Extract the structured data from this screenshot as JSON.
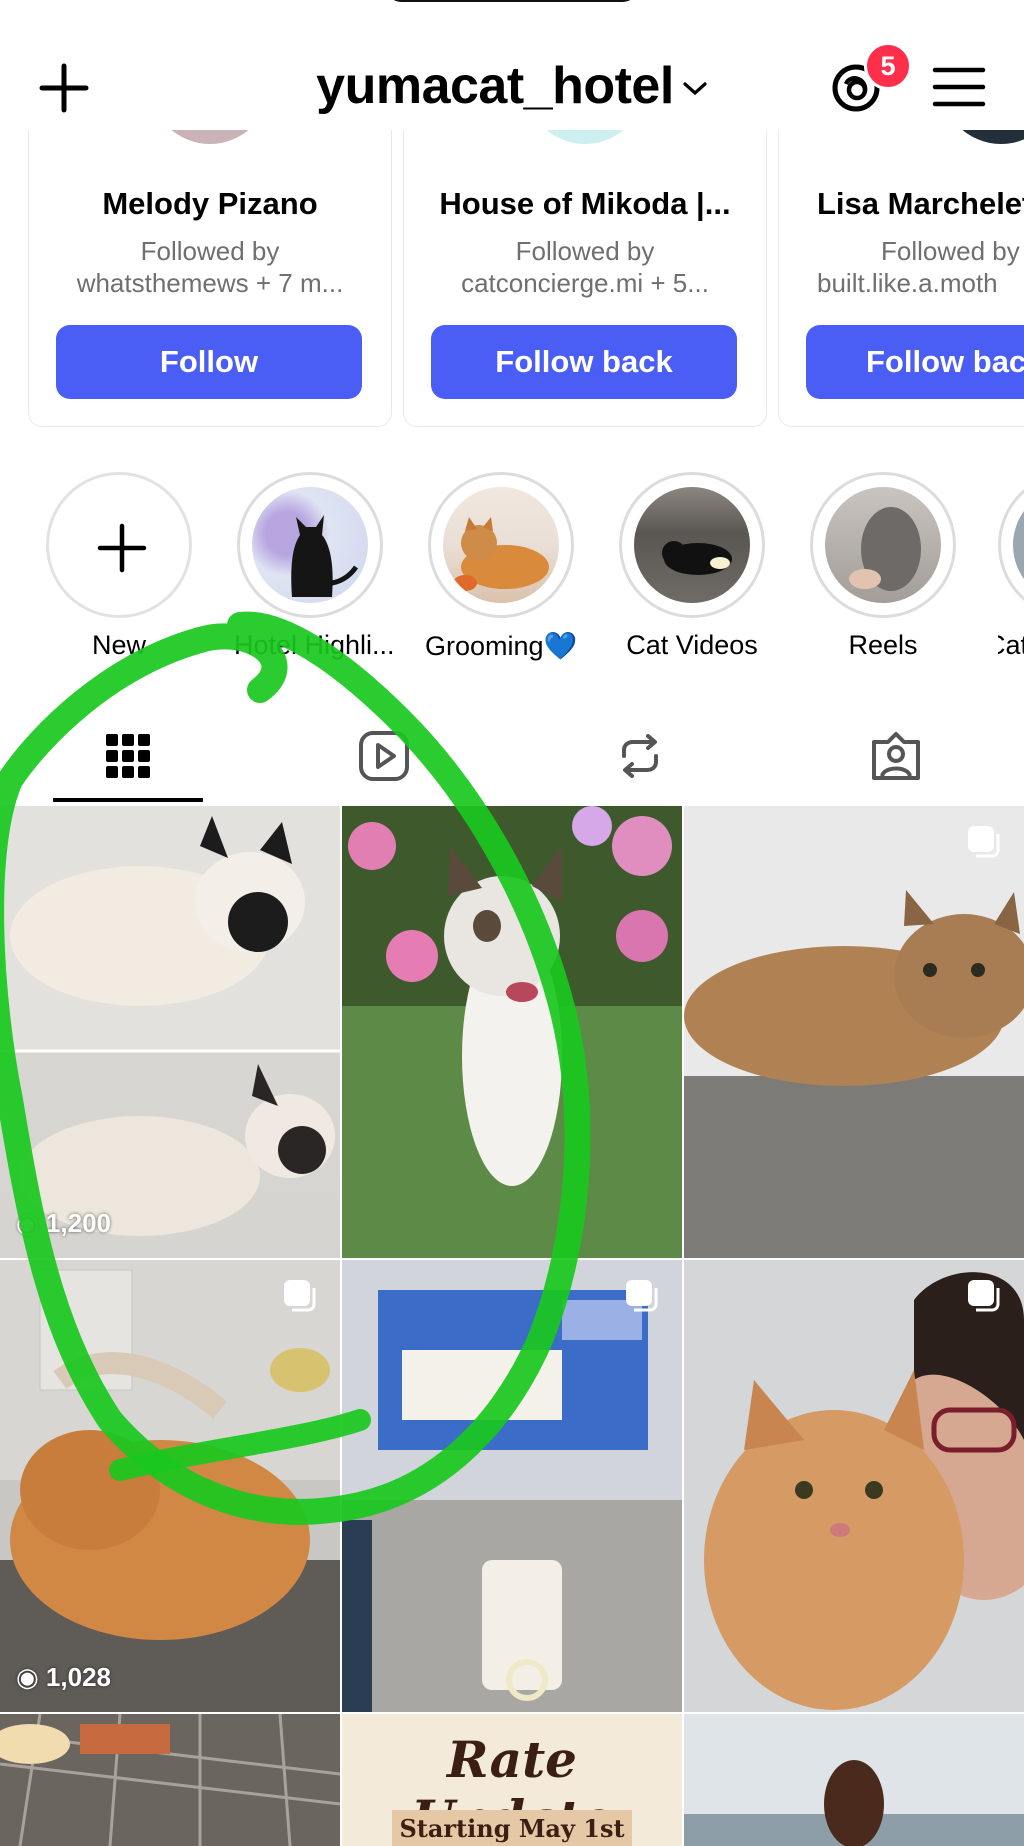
{
  "header": {
    "username": "yumacat_hotel",
    "notification_count": "5"
  },
  "suggestions": [
    {
      "name": "Melody Pizano",
      "followed_by_line1": "Followed by",
      "followed_by_line2": "whatsthemews + 7 m...",
      "button": "Follow"
    },
    {
      "name": "House of Mikoda |...",
      "followed_by_line1": "Followed by",
      "followed_by_line2": "catconcierge.mi + 5...",
      "button": "Follow back"
    },
    {
      "name": "Lisa Marchelet",
      "followed_by_line1": "Followed by",
      "followed_by_line2": "built.like.a.moth",
      "button": "Follow back"
    }
  ],
  "highlights": [
    {
      "label": "New"
    },
    {
      "label": "Hotel Highli..."
    },
    {
      "label": "Grooming💙"
    },
    {
      "label": "Cat Videos"
    },
    {
      "label": "Reels"
    },
    {
      "label": "Cat"
    }
  ],
  "tabs": [
    "grid-icon",
    "reels-icon",
    "reposts-icon",
    "tagged-icon"
  ],
  "grid": {
    "views_1": "1,200",
    "views_2": "1,028",
    "rate_title": "Rate Update",
    "rate_sub": "Starting May 1st"
  },
  "colors": {
    "follow_button": "#4a5ef5",
    "badge": "#ff2e4a",
    "annotation": "#19c81e"
  }
}
